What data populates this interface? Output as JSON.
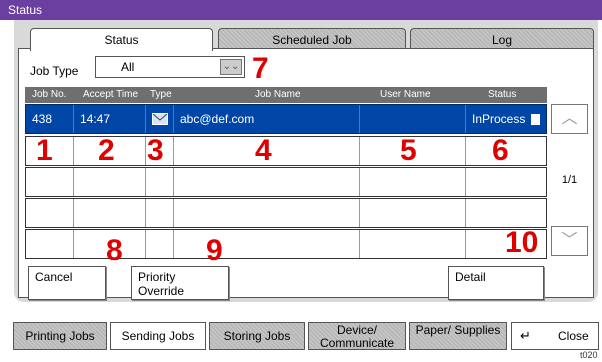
{
  "window": {
    "title": "Status"
  },
  "tabs": [
    "Status",
    "Scheduled Job",
    "Log"
  ],
  "job_type": {
    "label": "Job Type",
    "value": "All"
  },
  "table": {
    "headers": [
      "Job No.",
      "Accept Time",
      "Type",
      "Job Name",
      "User Name",
      "Status"
    ],
    "rows": [
      {
        "job_no": "438",
        "accept_time": "14:47",
        "type_icon": "mail-icon",
        "job_name": "abc@def.com",
        "user_name": "",
        "status": "InProcess"
      }
    ]
  },
  "pagination": {
    "indicator": "1/1"
  },
  "buttons": {
    "cancel": "Cancel",
    "priority_override": "Priority Override",
    "detail": "Detail",
    "close": "Close"
  },
  "bottom_tabs": [
    "Printing Jobs",
    "Sending Jobs",
    "Storing Jobs",
    "Device/ Communicate",
    "Paper/ Supplies"
  ],
  "callouts": [
    "1",
    "2",
    "3",
    "4",
    "5",
    "6",
    "7",
    "8",
    "9",
    "10"
  ],
  "figure_code": "t020",
  "colors": {
    "title_bar": "#6a3fa0",
    "selected_row": "#0046a6",
    "callout": "#e00000"
  }
}
